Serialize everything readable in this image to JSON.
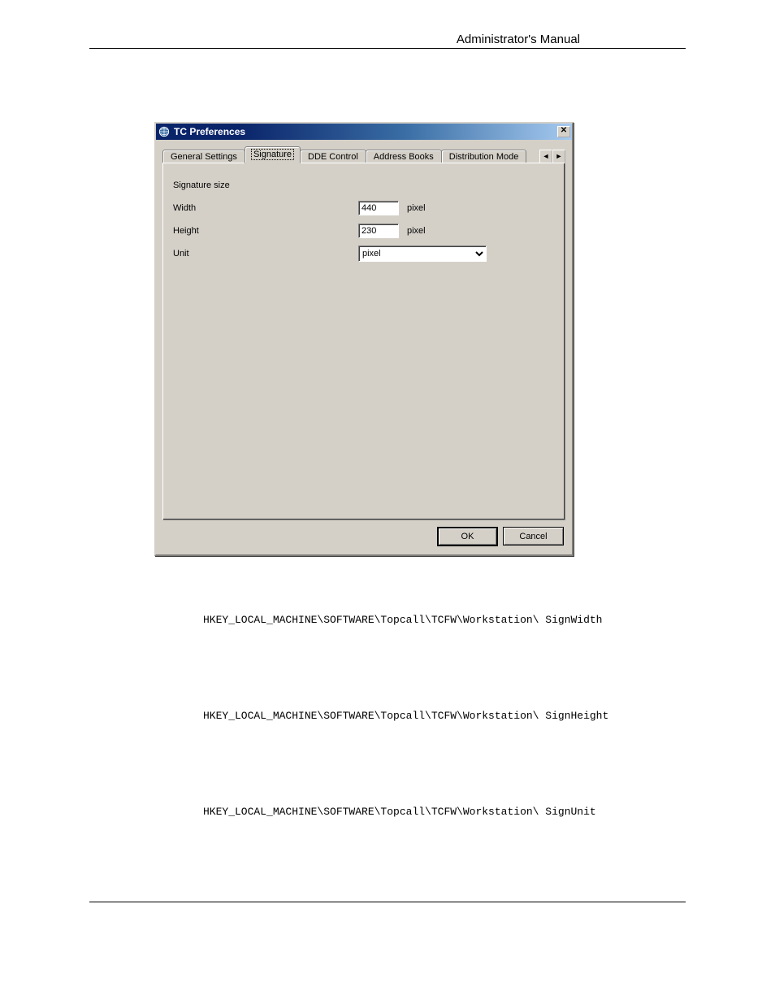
{
  "header": {
    "title": "Administrator's Manual"
  },
  "dialog": {
    "title": "TC Preferences",
    "tabs": {
      "items": [
        {
          "label": "General Settings"
        },
        {
          "label": "Signature"
        },
        {
          "label": "DDE Control"
        },
        {
          "label": "Address Books"
        },
        {
          "label": "Distribution Mode"
        }
      ],
      "scroll_left_glyph": "◄",
      "scroll_right_glyph": "►"
    },
    "signature_panel": {
      "section_label": "Signature size",
      "width_label": "Width",
      "width_value": "440",
      "width_suffix": "pixel",
      "height_label": "Height",
      "height_value": "230",
      "height_suffix": "pixel",
      "unit_label": "Unit",
      "unit_value": "pixel"
    },
    "buttons": {
      "ok": "OK",
      "cancel": "Cancel"
    },
    "close_glyph": "✕"
  },
  "registry": {
    "key1": "HKEY_LOCAL_MACHINE\\SOFTWARE\\Topcall\\TCFW\\Workstation\\ SignWidth",
    "key2": "HKEY_LOCAL_MACHINE\\SOFTWARE\\Topcall\\TCFW\\Workstation\\ SignHeight",
    "key3": "HKEY_LOCAL_MACHINE\\SOFTWARE\\Topcall\\TCFW\\Workstation\\ SignUnit"
  }
}
